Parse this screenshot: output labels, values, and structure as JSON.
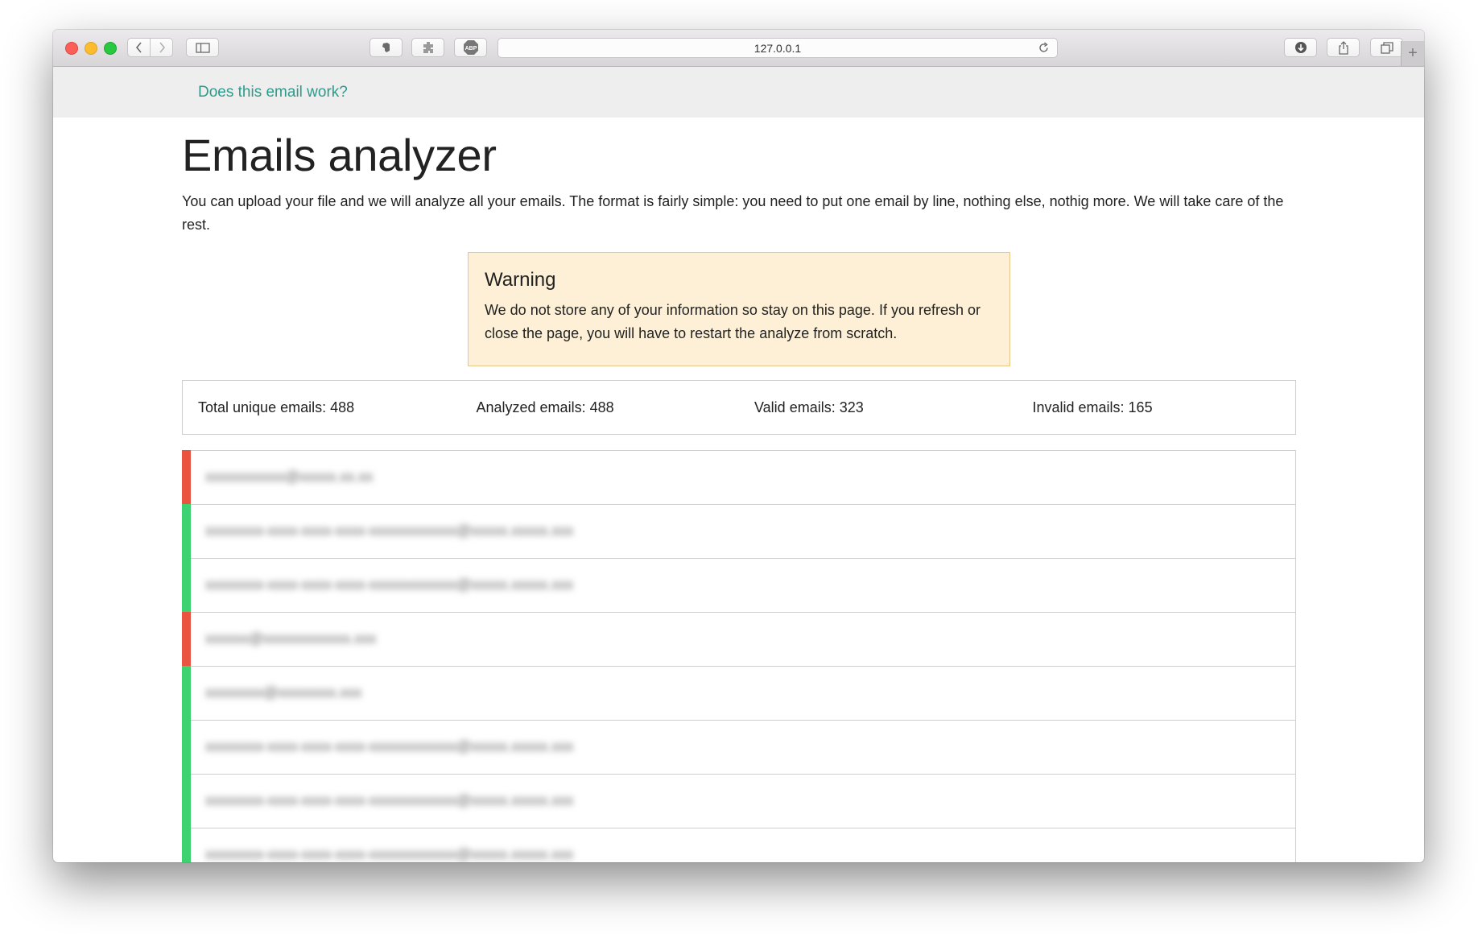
{
  "browser": {
    "url": "127.0.0.1",
    "new_tab_label": "+"
  },
  "navbar": {
    "brand": "Does this email work?"
  },
  "page": {
    "title": "Emails analyzer",
    "intro": "You can upload your file and we will analyze all your emails. The format is fairly simple: you need to put one email by line, nothing else, nothig more. We will take care of the rest."
  },
  "warning": {
    "title": "Warning",
    "text": "We do not store any of your information so stay on this page. If you refresh or close the page, you will have to restart the analyze from scratch."
  },
  "stats": {
    "total_label": "Total unique emails:",
    "total_value": "488",
    "analyzed_label": "Analyzed emails:",
    "analyzed_value": "488",
    "valid_label": "Valid emails:",
    "valid_value": "323",
    "invalid_label": "Invalid emails:",
    "invalid_value": "165"
  },
  "colors": {
    "valid": "#3cd271",
    "invalid": "#ea5340",
    "brand": "#2e9a8b",
    "warning_bg": "#fdf0d6",
    "warning_border": "#e6c989"
  },
  "emails": [
    {
      "address": "xxxxxxxxxxx@xxxxx.xx.xx",
      "status": "invalid"
    },
    {
      "address": "xxxxxxxx-xxxx-xxxx-xxxx-xxxxxxxxxxxx@xxxxx.xxxxx.xxx",
      "status": "valid"
    },
    {
      "address": "xxxxxxxx-xxxx-xxxx-xxxx-xxxxxxxxxxxx@xxxxx.xxxxx.xxx",
      "status": "valid"
    },
    {
      "address": "xxxxxx@xxxxxxxxxxxx.xxx",
      "status": "invalid"
    },
    {
      "address": "xxxxxxxx@xxxxxxxx.xxx",
      "status": "valid"
    },
    {
      "address": "xxxxxxxx-xxxx-xxxx-xxxx-xxxxxxxxxxxx@xxxxx.xxxxx.xxx",
      "status": "valid"
    },
    {
      "address": "xxxxxxxx-xxxx-xxxx-xxxx-xxxxxxxxxxxx@xxxxx.xxxxx.xxx",
      "status": "valid"
    },
    {
      "address": "xxxxxxxx-xxxx-xxxx-xxxx-xxxxxxxxxxxx@xxxxx.xxxxx.xxx",
      "status": "valid"
    }
  ]
}
